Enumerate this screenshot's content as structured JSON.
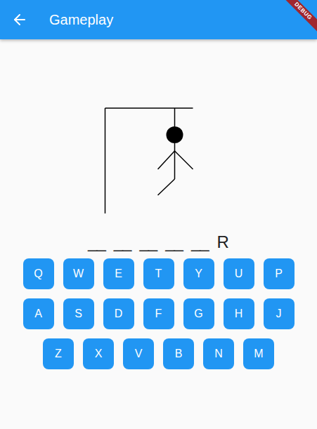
{
  "app_bar": {
    "title": "Gameplay"
  },
  "debug_banner": "DEBUG",
  "hangman": {
    "mistakes": 5
  },
  "word": [
    {
      "text": "__",
      "revealed": false
    },
    {
      "text": "__",
      "revealed": false
    },
    {
      "text": "__",
      "revealed": false
    },
    {
      "text": "__",
      "revealed": false
    },
    {
      "text": "__",
      "revealed": false
    },
    {
      "text": "R",
      "revealed": true
    }
  ],
  "keyboard": {
    "rows": [
      [
        "Q",
        "W",
        "E",
        "T",
        "Y",
        "U",
        "P"
      ],
      [
        "A",
        "S",
        "D",
        "F",
        "G",
        "H",
        "J"
      ],
      [
        "Z",
        "X",
        "V",
        "B",
        "N",
        "M"
      ]
    ]
  }
}
